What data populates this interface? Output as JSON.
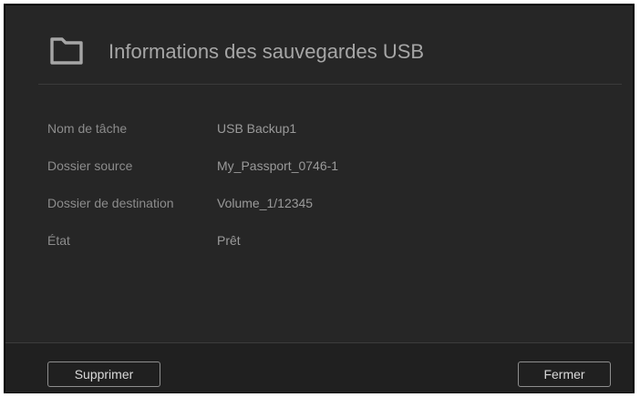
{
  "dialog": {
    "title": "Informations des sauvegardes USB",
    "icon": "folder-icon"
  },
  "details": [
    {
      "label": "Nom de tâche",
      "value": "USB Backup1"
    },
    {
      "label": "Dossier source",
      "value": "My_Passport_0746-1"
    },
    {
      "label": "Dossier de destination",
      "value": "Volume_1/12345"
    },
    {
      "label": "État",
      "value": "Prêt"
    }
  ],
  "buttons": {
    "delete_label": "Supprimer",
    "close_label": "Fermer"
  },
  "colors": {
    "background": "#262626",
    "footer": "#202020",
    "title_text": "#a6a6a6",
    "label_text": "#8c8c8c"
  }
}
